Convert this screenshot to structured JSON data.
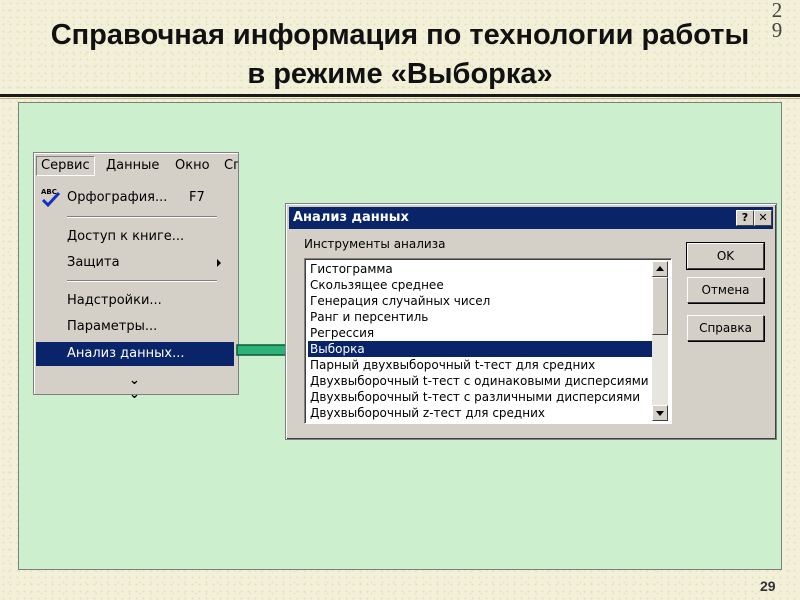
{
  "slide": {
    "title": "Справочная информация по технологии работы в режиме «Выборка»",
    "corner_number": "29",
    "page_number": "29"
  },
  "menu": {
    "menubar": [
      "Сервис",
      "Данные",
      "Окно",
      "Сп"
    ],
    "items": [
      {
        "label": "Орфография...",
        "shortcut": "F7"
      },
      {
        "label": "Доступ к книге..."
      },
      {
        "label": "Защита",
        "submenu": true
      },
      {
        "label": "Надстройки..."
      },
      {
        "label": "Параметры..."
      },
      {
        "label": "Анализ данных...",
        "selected": true
      }
    ],
    "more_icon": "double-chevron-down-icon"
  },
  "dialog": {
    "title": "Анализ данных",
    "help_button": "?",
    "close_button": "✕",
    "list_label": "Инструменты анализа",
    "tools": [
      "Гистограмма",
      "Скользящее среднее",
      "Генерация случайных чисел",
      "Ранг и персентиль",
      "Регрессия",
      "Выборка",
      "Парный двухвыборочный t-тест для средних",
      "Двухвыборочный t-тест с одинаковыми дисперсиями",
      "Двухвыборочный t-тест с различными дисперсиями",
      "Двухвыборочный z-тест для средних"
    ],
    "selected_tool": "Выборка",
    "buttons": {
      "ok": "OK",
      "cancel": "Отмена",
      "help": "Справка"
    }
  },
  "colors": {
    "panel": "#ccefcd",
    "selection": "#0a246a",
    "arrow": "#2db37a",
    "window_face": "#d4d0c8"
  }
}
